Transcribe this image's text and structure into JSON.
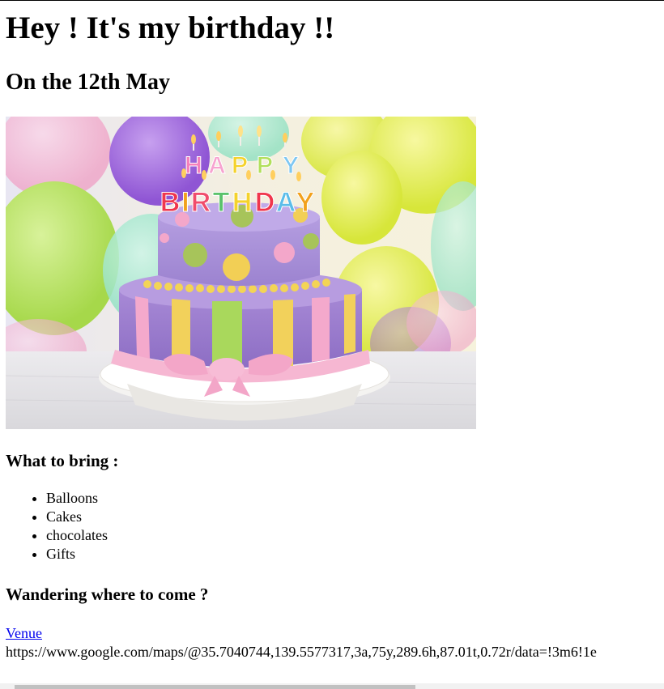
{
  "header": {
    "title": "Hey ! It's my birthday !!",
    "subtitle": "On the 12th May"
  },
  "image": {
    "alt": "Happy Birthday cake with candles and balloons",
    "candle_letters_row1": "HAPPY",
    "candle_letters_row2": "BIRTHDAY"
  },
  "bring": {
    "heading": "What to bring :",
    "items": [
      "Balloons",
      "Cakes",
      "chocolates",
      "Gifts"
    ]
  },
  "venue": {
    "heading": "Wandering where to come ?",
    "link_label": "Venue",
    "url_text": "https://www.google.com/maps/@35.7040744,139.5577317,3a,75y,289.6h,87.01t,0.72r/data=!3m6!1e"
  },
  "colors": {
    "link": "#0000ee",
    "text": "#000000",
    "scroll_track": "#f1f1f1",
    "scroll_thumb": "#c1c1c1"
  },
  "scrollbar": {
    "orientation": "horizontal",
    "left_arrow": "scroll-left-arrow-icon",
    "right_arrow": "scroll-right-arrow-icon"
  }
}
